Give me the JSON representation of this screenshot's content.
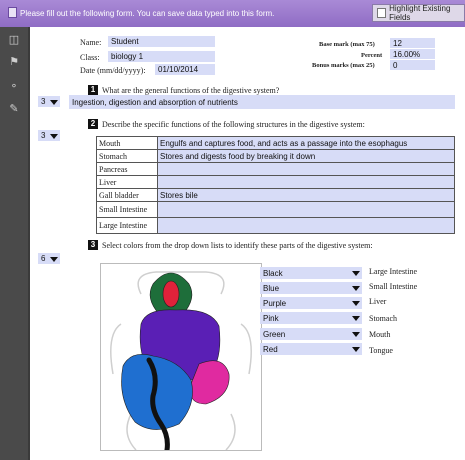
{
  "banner": {
    "message": "Please fill out the following form. You can save data typed into this form.",
    "highlight_button": "Highlight Existing Fields"
  },
  "form": {
    "name_label": "Name:",
    "name_value": "Student",
    "class_label": "Class:",
    "class_value": "biology 1",
    "date_label": "Date (mm/dd/yyyy):",
    "date_value": "01/10/2014",
    "base_mark_label": "Base mark (max 75)",
    "base_mark_value": "12",
    "percent_label": "Percent",
    "percent_value": "16.00%",
    "bonus_label": "Bonus marks (max 25)",
    "bonus_value": "0"
  },
  "q1": {
    "number": "1",
    "question": "What are the general functions of the digestive system?",
    "score": "3",
    "answer": "Ingestion, digestion and absorption of nutrients"
  },
  "q2": {
    "number": "2",
    "question": "Describe the specific functions of the following structures in the digestive system:",
    "score": "3",
    "rows": [
      {
        "name": "Mouth",
        "answer": "Engulfs and captures food, and acts as a passage into the esophagus"
      },
      {
        "name": "Stomach",
        "answer": "Stores and digests food by breaking it down"
      },
      {
        "name": "Pancreas",
        "answer": ""
      },
      {
        "name": "Liver",
        "answer": ""
      },
      {
        "name": "Gall bladder",
        "answer": "Stores bile"
      },
      {
        "name": "Small Intestine",
        "answer": ""
      },
      {
        "name": "Large Intestine",
        "answer": ""
      }
    ]
  },
  "q3": {
    "number": "3",
    "question": "Select colors from the drop down lists to identify these parts of the digestive system:",
    "score": "6",
    "selects": [
      {
        "color": "Black",
        "part": "Large Intestine"
      },
      {
        "color": "Blue",
        "part": "Small Intestine"
      },
      {
        "color": "Purple",
        "part": "Liver"
      },
      {
        "color": "Pink",
        "part": "Stomach"
      },
      {
        "color": "Green",
        "part": "Mouth"
      },
      {
        "color": "Red",
        "part": "Tongue"
      }
    ]
  },
  "colors": {
    "field_bg": "#d7dcf7",
    "banner": "#9b7acc",
    "green": "#1e6e3a",
    "red": "#e0223a",
    "purple": "#5a1fb5",
    "blue": "#1f6fd0",
    "pink": "#e02aa0",
    "black": "#111111"
  }
}
